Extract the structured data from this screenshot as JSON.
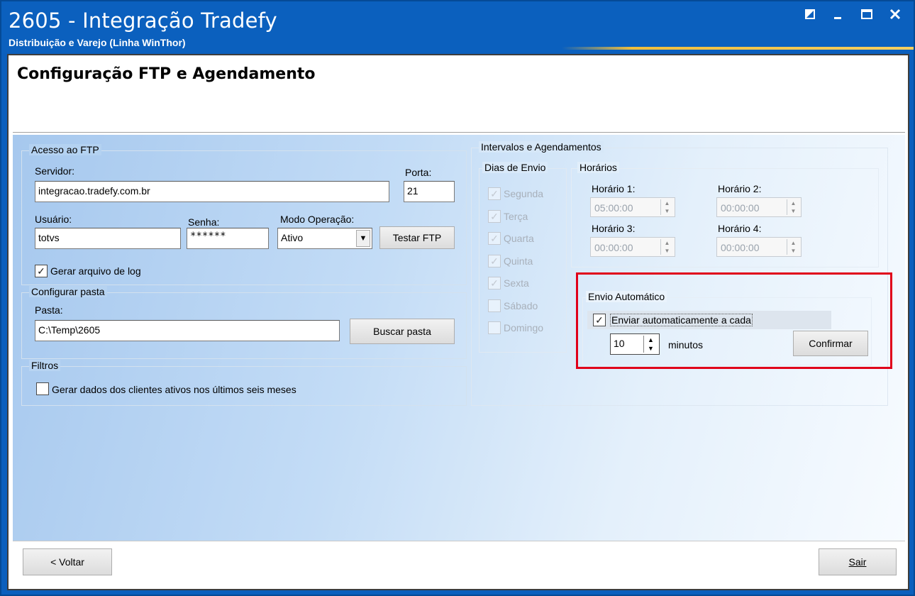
{
  "window": {
    "title": "2605 - Integração Tradefy",
    "subtitle": "Distribuição e Varejo (Linha WinThor)",
    "controls": [
      "restore-icon",
      "minimize-icon",
      "maximize-icon",
      "close-icon"
    ]
  },
  "page": {
    "title": "Configuração FTP e Agendamento"
  },
  "ftp": {
    "legend": "Acesso ao FTP",
    "server_label": "Servidor:",
    "server_value": "integracao.tradefy.com.br",
    "port_label": "Porta:",
    "port_value": "21",
    "user_label": "Usuário:",
    "user_value": "totvs",
    "password_label": "Senha:",
    "password_value": "******",
    "mode_label": "Modo Operação:",
    "mode_value": "Ativo",
    "test_button": "Testar FTP",
    "log_checkbox": "Gerar arquivo de log",
    "log_checked": true
  },
  "folder": {
    "legend": "Configurar pasta",
    "path_label": "Pasta:",
    "path_value": "C:\\Temp\\2605",
    "browse_button": "Buscar pasta"
  },
  "filters": {
    "legend": "Filtros",
    "active_clients_checkbox": "Gerar dados dos clientes ativos nos últimos seis meses",
    "active_clients_checked": false
  },
  "schedule": {
    "legend": "Intervalos e Agendamentos",
    "days_legend": "Dias de Envio",
    "days": [
      {
        "label": "Segunda",
        "checked": true
      },
      {
        "label": "Terça",
        "checked": true
      },
      {
        "label": "Quarta",
        "checked": true
      },
      {
        "label": "Quinta",
        "checked": true
      },
      {
        "label": "Sexta",
        "checked": true
      },
      {
        "label": "Sábado",
        "checked": false
      },
      {
        "label": "Domingo",
        "checked": false
      }
    ],
    "times_legend": "Horários",
    "time1_label": "Horário 1:",
    "time1_value": "05:00:00",
    "time2_label": "Horário 2:",
    "time2_value": "00:00:00",
    "time3_label": "Horário 3:",
    "time3_value": "00:00:00",
    "time4_label": "Horário 4:",
    "time4_value": "00:00:00"
  },
  "auto_send": {
    "legend": "Envio Automático",
    "checkbox_label": "Enviar automaticamente a cada",
    "checked": true,
    "interval_value": "10",
    "interval_unit": "minutos",
    "confirm_button": "Confirmar"
  },
  "footer": {
    "back_button": "< Voltar",
    "exit_button": "Sair"
  },
  "colors": {
    "titlebar": "#0b60be",
    "highlight": "#e0001a",
    "accent": "#f0be3c"
  }
}
